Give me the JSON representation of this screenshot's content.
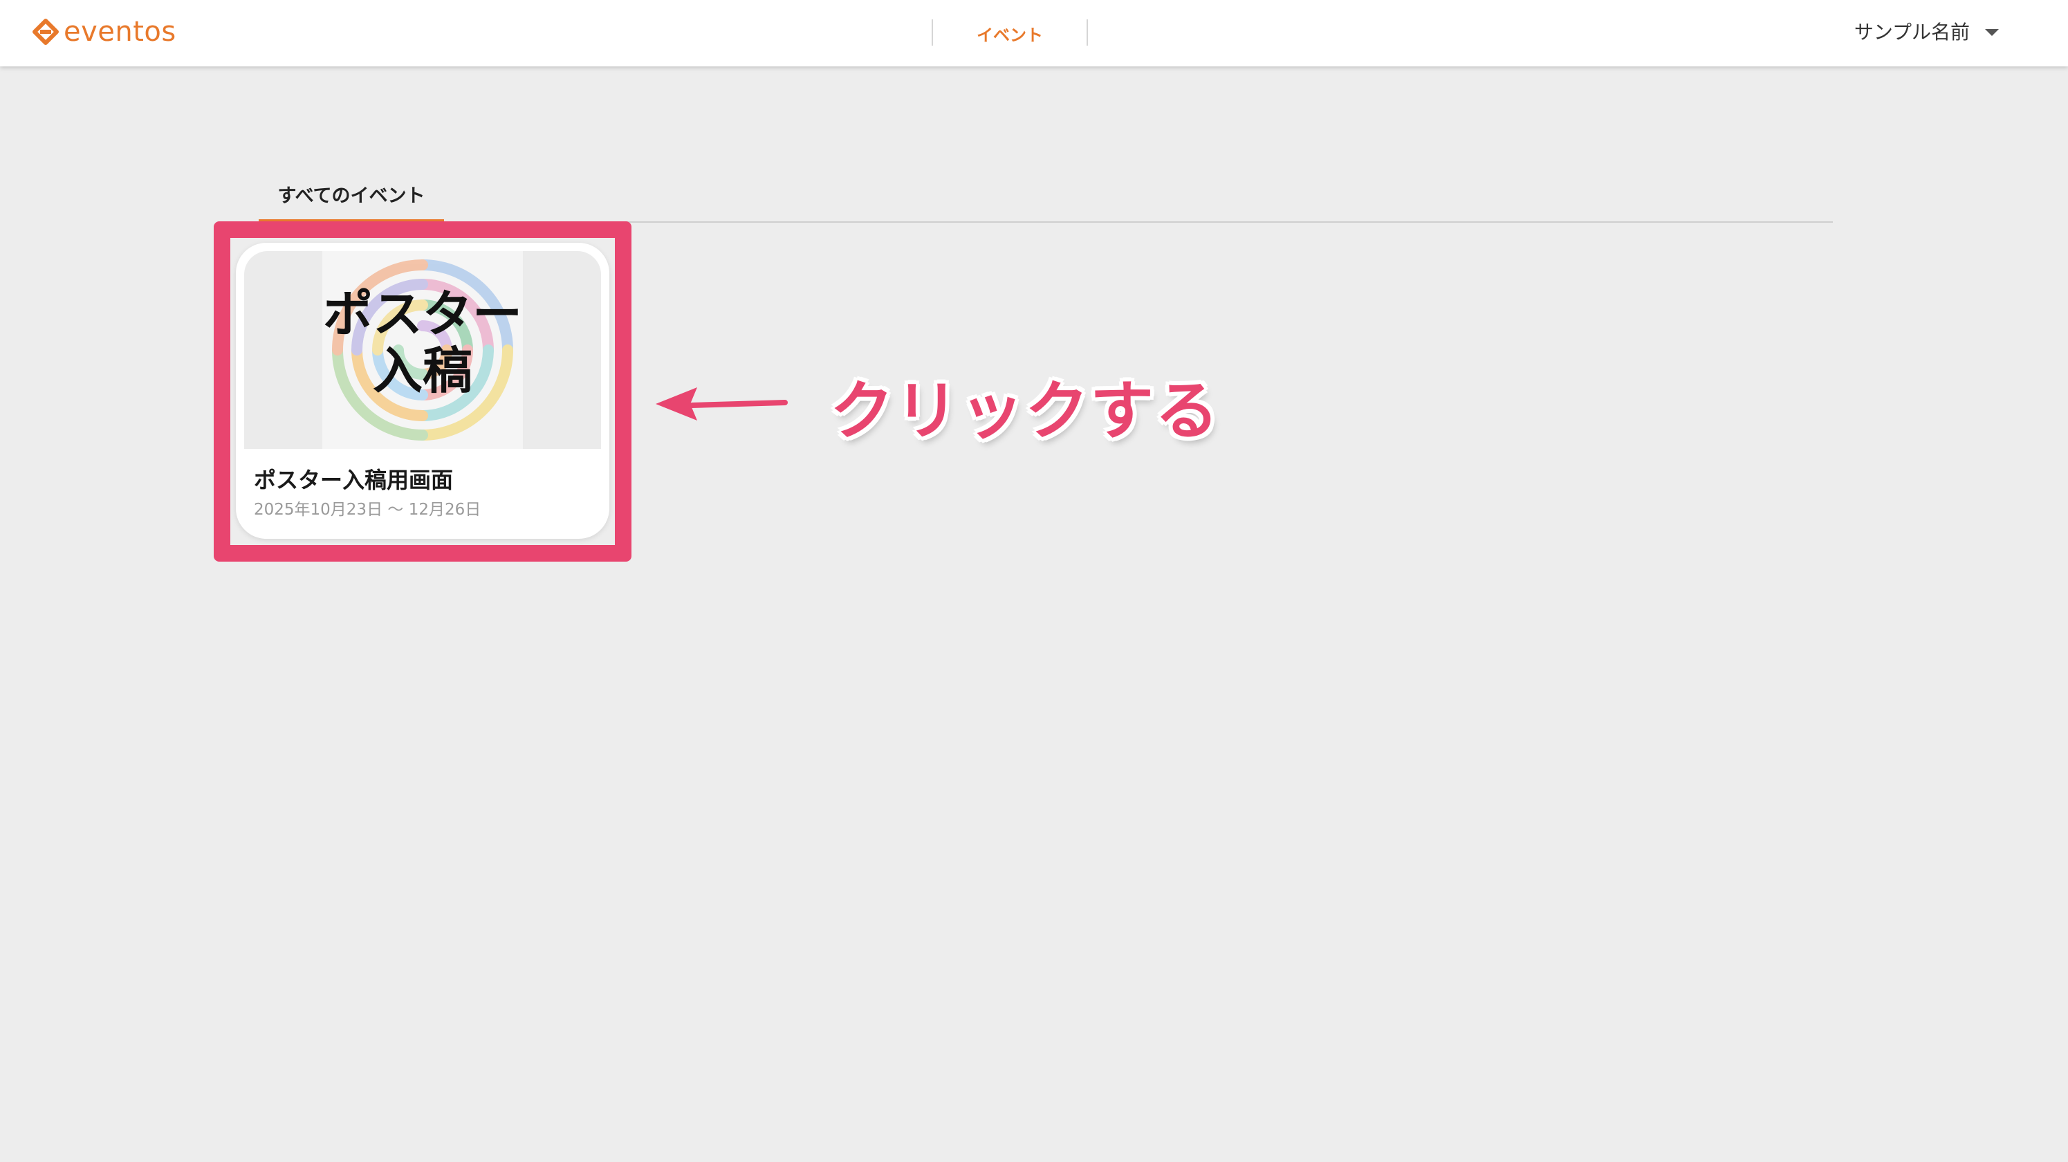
{
  "header": {
    "logo_text": "eventos",
    "brand_color": "#e8792b",
    "nav_item": "イベント",
    "user_name": "サンプル名前"
  },
  "tabs": [
    {
      "label": "すべてのイベント",
      "active": true
    }
  ],
  "events": [
    {
      "thumbnail_text_line1": "ポスター",
      "thumbnail_text_line2": "入稿",
      "title": "ポスター入稿用画面",
      "dates": "2025年10月23日 〜 12月26日"
    }
  ],
  "annotation": {
    "text": "クリックする",
    "color": "#e8456f"
  },
  "icons": {
    "logo": "eventos-logo-icon",
    "user_menu": "caret-down-icon",
    "pointer": "arrow-left-icon"
  }
}
